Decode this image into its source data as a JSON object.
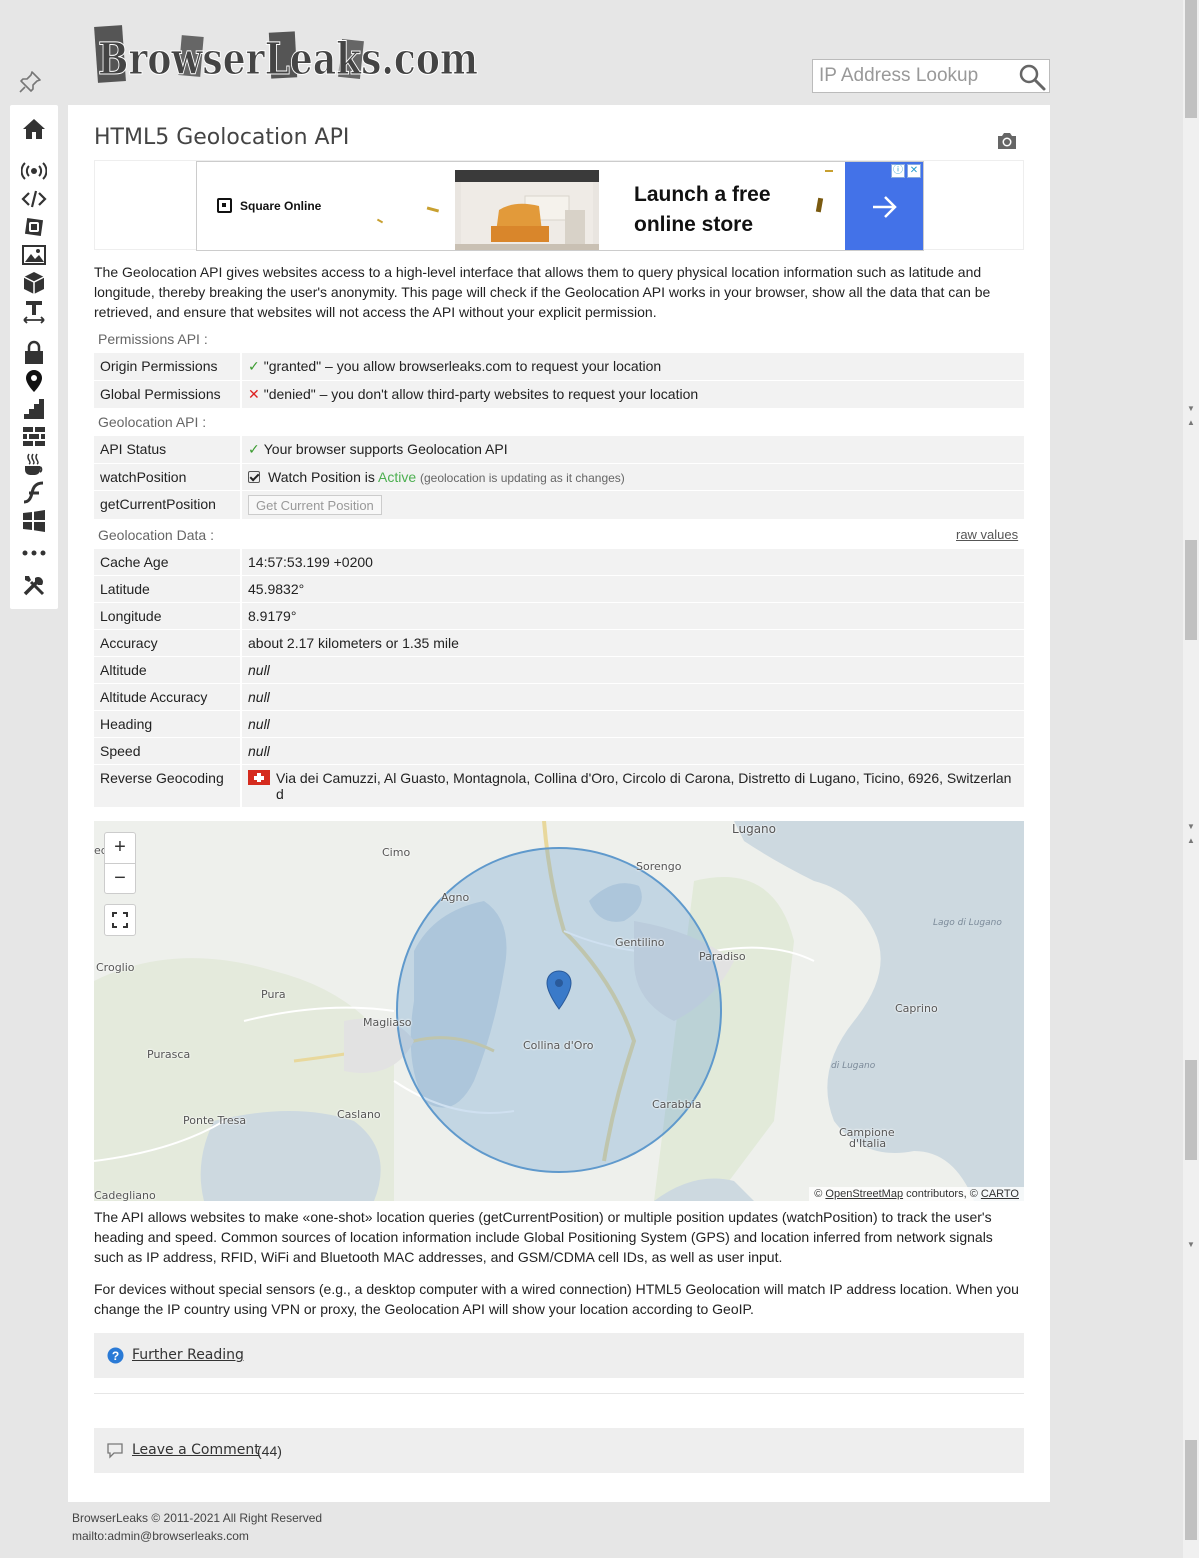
{
  "header": {
    "logo_text": "BrowserLeaks.com",
    "search_placeholder": "IP Address Lookup"
  },
  "sidebar": {
    "items": [
      {
        "name": "home-icon"
      },
      {
        "name": "webrtc-icon"
      },
      {
        "name": "javascript-icon"
      },
      {
        "name": "chrome-icon"
      },
      {
        "name": "canvas-icon"
      },
      {
        "name": "webgl-icon"
      },
      {
        "name": "fonts-icon"
      },
      {
        "name": "ssl-icon"
      },
      {
        "name": "geolocation-icon"
      },
      {
        "name": "features-icon"
      },
      {
        "name": "firewall-icon"
      },
      {
        "name": "java-icon"
      },
      {
        "name": "flash-icon"
      },
      {
        "name": "windows-icon"
      },
      {
        "name": "more-icon"
      },
      {
        "name": "tools-icon"
      }
    ]
  },
  "page": {
    "title": "HTML5 Geolocation API",
    "intro": "The Geolocation API gives websites access to a high-level interface that allows them to query physical location information such as latitude and longitude, thereby breaking the user's anonymity. This page will check if the Geolocation API works in your browser, show all the data that can be retrieved, and ensure that websites will not access the API without your explicit permission."
  },
  "ad": {
    "brand": "Square Online",
    "headline": "Launch a free online store"
  },
  "permissions": {
    "label": "Permissions API :",
    "rows": [
      {
        "key": "Origin Permissions",
        "value": "\"granted\" – you allow browserleaks.com to request your location"
      },
      {
        "key": "Global Permissions",
        "value": "\"denied\" – you don't allow third-party websites to request your location"
      }
    ]
  },
  "geolocation_api": {
    "label": "Geolocation API :",
    "api_status_key": "API Status",
    "api_status_value": "Your browser supports Geolocation API",
    "watch_key": "watchPosition",
    "watch_prefix": "Watch Position is",
    "watch_state": "Active",
    "watch_note": "(geolocation is updating as it changes)",
    "current_key": "getCurrentPosition",
    "current_button": "Get Current Position"
  },
  "geolocation_data": {
    "label": "Geolocation Data :",
    "raw_link": "raw values",
    "rows": [
      {
        "key": "Cache Age",
        "value": "14:57:53.199 +0200"
      },
      {
        "key": "Latitude",
        "value": "45.9832°"
      },
      {
        "key": "Longitude",
        "value": "8.9179°"
      },
      {
        "key": "Accuracy",
        "value": "about 2.17 kilometers or 1.35 mile"
      },
      {
        "key": "Altitude",
        "value": "null"
      },
      {
        "key": "Altitude Accuracy",
        "value": "null"
      },
      {
        "key": "Heading",
        "value": "null"
      },
      {
        "key": "Speed",
        "value": "null"
      }
    ],
    "reverse_key": "Reverse Geocoding",
    "reverse_value": "Via dei Camuzzi, Al Guasto, Montagnola, Collina d'Oro, Circolo di Carona, Distretto di Lugano, Ticino, 6926, Switzerland"
  },
  "map": {
    "labels": {
      "lugano": "Lugano",
      "cimo": "Cimo",
      "sorengo": "Sorengo",
      "agno": "Agno",
      "gentilino": "Gentilino",
      "paradiso": "Paradiso",
      "lago": "Lago di Lugano",
      "croglio": "Croglio",
      "pura": "Pura",
      "magliaso": "Magliaso",
      "caprino": "Caprino",
      "collina": "Collina d'Oro",
      "purasca": "Purasca",
      "di_lugano": "di Lugano",
      "carabbia": "Carabbia",
      "ponte_tresa": "Ponte Tresa",
      "caslano": "Caslano",
      "campione": "Campione",
      "campione2": "d'Italia",
      "cadegliano": "Cadegliano",
      "edge": "edi"
    },
    "zoom_in": "+",
    "zoom_out": "−",
    "attribution_prefix": "©",
    "attribution_osm": "OpenStreetMap",
    "attribution_mid": "contributors, ©",
    "attribution_carto": "CARTO"
  },
  "paragraphs": {
    "one": "The API allows websites to make «one-shot» location queries (getCurrentPosition) or multiple position updates (watchPosition) to track the user's heading and speed. Common sources of location information include Global Positioning System (GPS) and location inferred from network signals such as IP address, RFID, WiFi and Bluetooth MAC addresses, and GSM/CDMA cell IDs, as well as user input.",
    "two": "For devices without special sensors (e.g., a desktop computer with a wired connection) HTML5 Geolocation will match IP address location. When you change the IP country using VPN or proxy, the Geolocation API will show your location according to GeoIP."
  },
  "further_reading": "Further Reading",
  "comments": {
    "label": "Leave a Comment",
    "count": "(44)"
  },
  "footer": {
    "copyright": "BrowserLeaks © 2011-2021 All Right Reserved",
    "mail": "mailto:admin@browserleaks.com"
  }
}
